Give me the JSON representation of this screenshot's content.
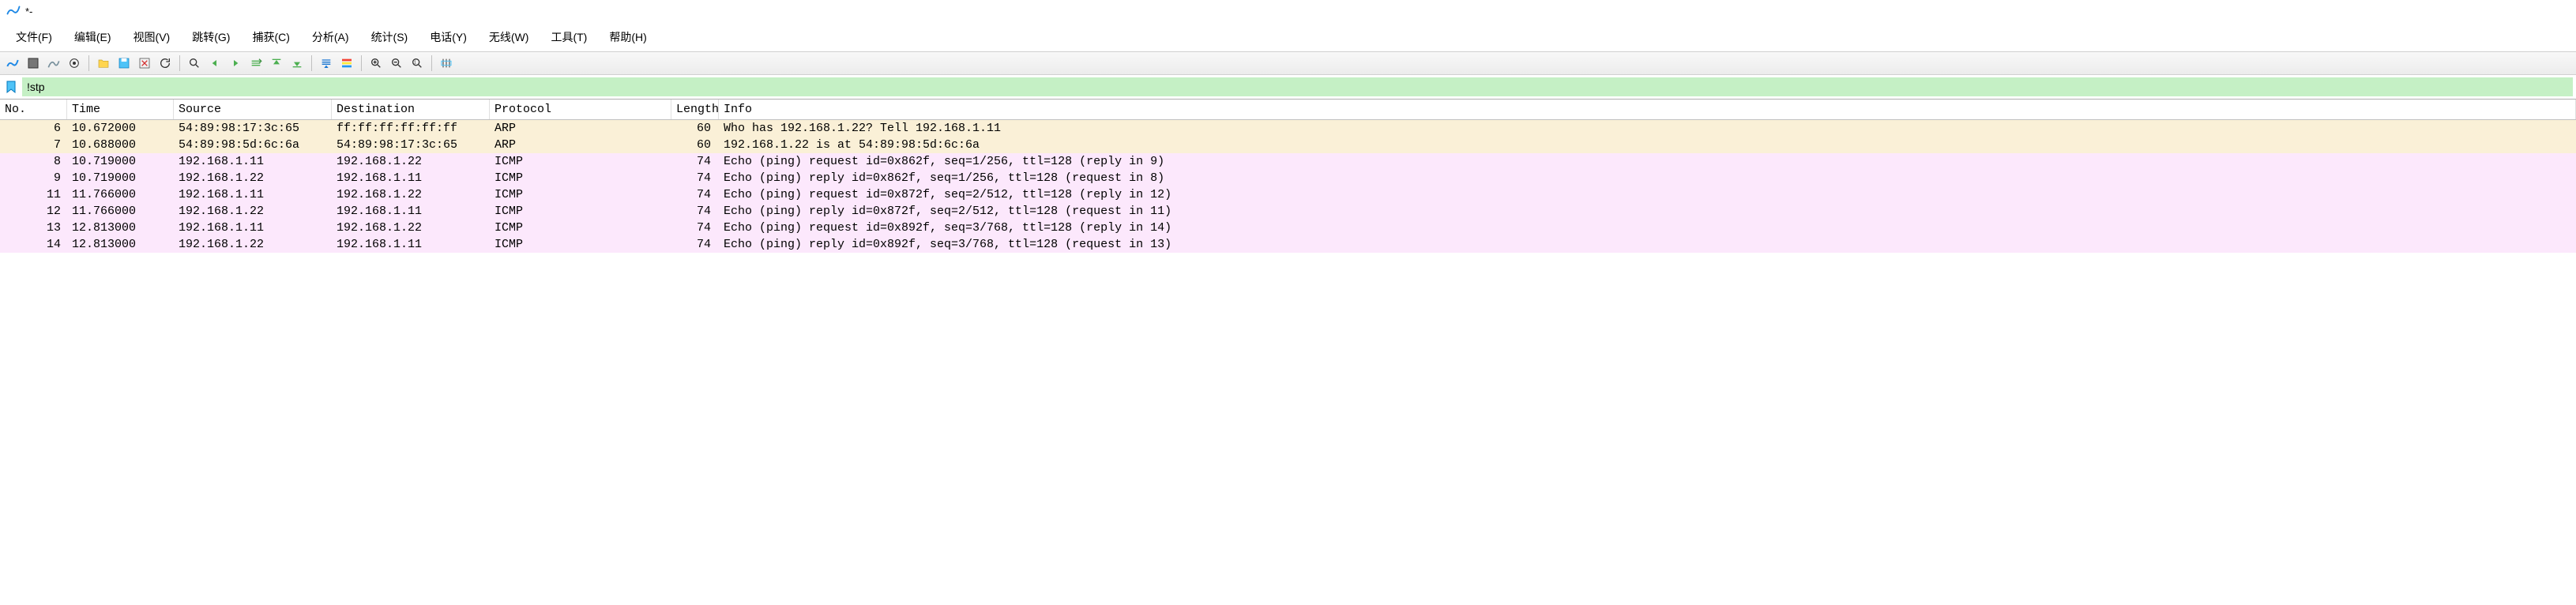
{
  "title": "*-",
  "menu": [
    "文件(F)",
    "编辑(E)",
    "视图(V)",
    "跳转(G)",
    "捕获(C)",
    "分析(A)",
    "统计(S)",
    "电话(Y)",
    "无线(W)",
    "工具(T)",
    "帮助(H)"
  ],
  "filter": "!stp",
  "columns": [
    "No.",
    "Time",
    "Source",
    "Destination",
    "Protocol",
    "Length",
    "Info"
  ],
  "packets": [
    {
      "no": "6",
      "time": "10.672000",
      "src": "54:89:98:17:3c:65",
      "dst": "ff:ff:ff:ff:ff:ff",
      "proto": "ARP",
      "len": "60",
      "info": "Who has 192.168.1.22? Tell 192.168.1.11",
      "cls": "row-arp",
      "sel": true
    },
    {
      "no": "7",
      "time": "10.688000",
      "src": "54:89:98:5d:6c:6a",
      "dst": "54:89:98:17:3c:65",
      "proto": "ARP",
      "len": "60",
      "info": "192.168.1.22 is at 54:89:98:5d:6c:6a",
      "cls": "row-arp"
    },
    {
      "no": "8",
      "time": "10.719000",
      "src": "192.168.1.11",
      "dst": "192.168.1.22",
      "proto": "ICMP",
      "len": "74",
      "info": "Echo (ping) request  id=0x862f, seq=1/256, ttl=128 (reply in 9)",
      "cls": "row-icmp"
    },
    {
      "no": "9",
      "time": "10.719000",
      "src": "192.168.1.22",
      "dst": "192.168.1.11",
      "proto": "ICMP",
      "len": "74",
      "info": "Echo (ping) reply    id=0x862f, seq=1/256, ttl=128 (request in 8)",
      "cls": "row-icmp"
    },
    {
      "no": "11",
      "time": "11.766000",
      "src": "192.168.1.11",
      "dst": "192.168.1.22",
      "proto": "ICMP",
      "len": "74",
      "info": "Echo (ping) request  id=0x872f, seq=2/512, ttl=128 (reply in 12)",
      "cls": "row-icmp"
    },
    {
      "no": "12",
      "time": "11.766000",
      "src": "192.168.1.22",
      "dst": "192.168.1.11",
      "proto": "ICMP",
      "len": "74",
      "info": "Echo (ping) reply    id=0x872f, seq=2/512, ttl=128 (request in 11)",
      "cls": "row-icmp"
    },
    {
      "no": "13",
      "time": "12.813000",
      "src": "192.168.1.11",
      "dst": "192.168.1.22",
      "proto": "ICMP",
      "len": "74",
      "info": "Echo (ping) request  id=0x892f, seq=3/768, ttl=128 (reply in 14)",
      "cls": "row-icmp"
    },
    {
      "no": "14",
      "time": "12.813000",
      "src": "192.168.1.22",
      "dst": "192.168.1.11",
      "proto": "ICMP",
      "len": "74",
      "info": "Echo (ping) reply    id=0x892f, seq=3/768, ttl=128 (request in 13)",
      "cls": "row-icmp"
    }
  ]
}
